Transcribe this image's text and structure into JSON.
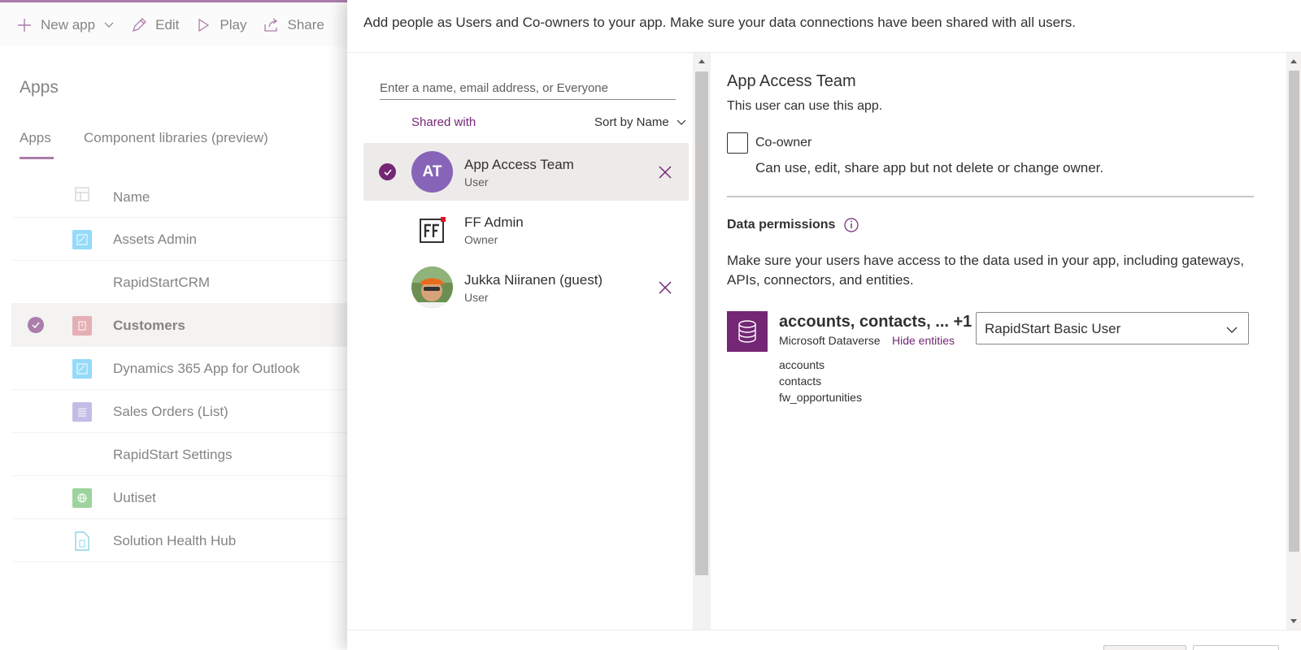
{
  "commandbar": {
    "new_app": "New app",
    "edit": "Edit",
    "play": "Play",
    "share": "Share"
  },
  "apps_page": {
    "title": "Apps",
    "tabs": [
      "Apps",
      "Component libraries (preview)"
    ],
    "column_name": "Name",
    "rows": [
      {
        "label": "Assets Admin",
        "icon": "canvas-app-icon",
        "color": "#4fc3f7"
      },
      {
        "label": "RapidStartCRM",
        "icon": "",
        "color": ""
      },
      {
        "label": "Customers",
        "icon": "model-app-icon",
        "color": "#d47a85"
      },
      {
        "label": "Dynamics 365 App for Outlook",
        "icon": "canvas-app-icon",
        "color": "#4fc3f7"
      },
      {
        "label": "Sales Orders (List)",
        "icon": "list-app-icon",
        "color": "#9e8fd6"
      },
      {
        "label": "RapidStart Settings",
        "icon": "",
        "color": ""
      },
      {
        "label": "Uutiset",
        "icon": "globe-app-icon",
        "color": "#5cb85c"
      },
      {
        "label": "Solution Health Hub",
        "icon": "document-app-icon",
        "color": "#3fb8d6"
      }
    ]
  },
  "share_panel": {
    "header": "Add people as Users and Co-owners to your app. Make sure your data connections have been shared with all users.",
    "search_placeholder": "Enter a name, email address, or Everyone",
    "shared_with": "Shared with",
    "sort_by": "Sort by Name",
    "people": [
      {
        "name": "App Access Team",
        "role": "User",
        "initials": "AT"
      },
      {
        "name": "FF Admin",
        "role": "Owner",
        "initials": "FF"
      },
      {
        "name": "Jukka Niiranen (guest)",
        "role": "User",
        "initials": ""
      }
    ],
    "detail": {
      "title": "App Access Team",
      "subtitle": "This user can use this app.",
      "coowner_label": "Co-owner",
      "coowner_desc": "Can use, edit, share app but not delete or change owner.",
      "data_permissions_title": "Data permissions",
      "data_permissions_desc": "Make sure your users have access to the data used in your app, including gateways, APIs, connectors, and entities.",
      "datasource_name": "accounts, contacts, ... +1",
      "datasource_provider": "Microsoft Dataverse",
      "hide_entities": "Hide entities",
      "entities": [
        "accounts",
        "contacts",
        "fw_opportunities"
      ],
      "role_selected": "RapidStart Basic User"
    }
  },
  "colors": {
    "accent": "#742774",
    "avatar_at": "#8764b8"
  }
}
